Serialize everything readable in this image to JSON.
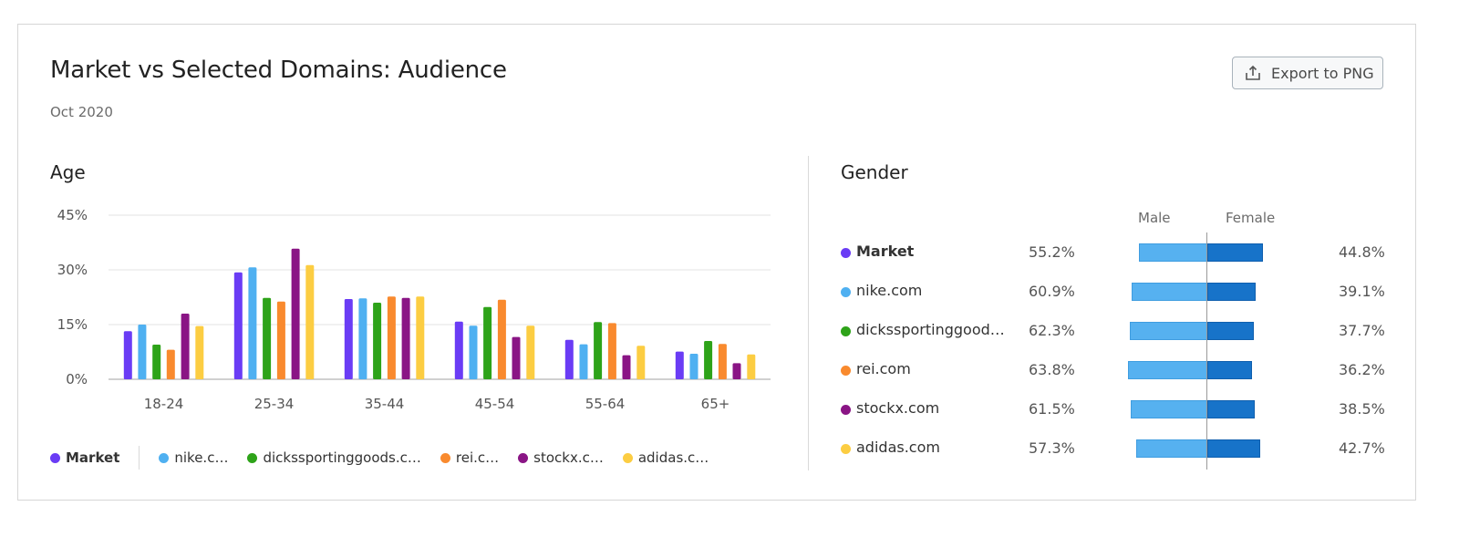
{
  "header": {
    "title": "Market vs Selected Domains: Audience",
    "subtitle": "Oct 2020",
    "export_label": "Export to PNG"
  },
  "age": {
    "section_title": "Age"
  },
  "gender": {
    "section_title": "Gender",
    "male_label": "Male",
    "female_label": "Female"
  },
  "legend": [
    {
      "label": "Market",
      "color": "#6a3cf5",
      "bold": true
    },
    {
      "label": "nike.c…",
      "color": "#4fb0f1"
    },
    {
      "label": "dickssportinggoods.c…",
      "color": "#2ea319"
    },
    {
      "label": "rei.c…",
      "color": "#f98a2e"
    },
    {
      "label": "stockx.c…",
      "color": "#8a1585"
    },
    {
      "label": "adidas.c…",
      "color": "#fccd42"
    }
  ],
  "chart_data": [
    {
      "type": "bar",
      "title": "Age",
      "categories": [
        "18-24",
        "25-34",
        "35-44",
        "45-54",
        "55-64",
        "65+"
      ],
      "ylim": [
        0,
        45
      ],
      "yticks": [
        "0%",
        "15%",
        "30%",
        "45%"
      ],
      "ytick_values": [
        0,
        15,
        30,
        45
      ],
      "grid": true,
      "legend_position": "bottom",
      "series": [
        {
          "name": "Market",
          "color": "#6a3cf5",
          "values": [
            13.2,
            29.3,
            22.0,
            15.8,
            10.8,
            7.6
          ]
        },
        {
          "name": "nike.com",
          "color": "#4fb0f1",
          "values": [
            15.0,
            30.7,
            22.2,
            14.7,
            9.6,
            7.0
          ]
        },
        {
          "name": "dickssportinggoods.com",
          "color": "#2ea319",
          "values": [
            9.5,
            22.3,
            21.0,
            19.8,
            15.7,
            10.5
          ]
        },
        {
          "name": "rei.com",
          "color": "#f98a2e",
          "values": [
            8.1,
            21.3,
            22.7,
            21.8,
            15.4,
            9.7
          ]
        },
        {
          "name": "stockx.com",
          "color": "#8a1585",
          "values": [
            18.0,
            35.8,
            22.3,
            11.6,
            6.6,
            4.4
          ]
        },
        {
          "name": "adidas.com",
          "color": "#fccd42",
          "values": [
            14.6,
            31.3,
            22.7,
            14.7,
            9.2,
            6.8
          ]
        }
      ]
    },
    {
      "type": "bar",
      "title": "Gender",
      "categories": [
        "Male",
        "Female"
      ],
      "orientation": "horizontal-diverging",
      "series": [
        {
          "name": "Market",
          "color": "#6a3cf5",
          "bold": true,
          "male": 55.2,
          "female": 44.8,
          "male_label": "55.2%",
          "female_label": "44.8%"
        },
        {
          "name": "nike.com",
          "color": "#4fb0f1",
          "male": 60.9,
          "female": 39.1,
          "male_label": "60.9%",
          "female_label": "39.1%"
        },
        {
          "name": "dickssportinggood…",
          "color": "#2ea319",
          "male": 62.3,
          "female": 37.7,
          "male_label": "62.3%",
          "female_label": "37.7%"
        },
        {
          "name": "rei.com",
          "color": "#f98a2e",
          "male": 63.8,
          "female": 36.2,
          "male_label": "63.8%",
          "female_label": "36.2%"
        },
        {
          "name": "stockx.com",
          "color": "#8a1585",
          "male": 61.5,
          "female": 38.5,
          "male_label": "61.5%",
          "female_label": "38.5%"
        },
        {
          "name": "adidas.com",
          "color": "#fccd42",
          "male": 57.3,
          "female": 42.7,
          "male_label": "57.3%",
          "female_label": "42.7%"
        }
      ]
    }
  ]
}
